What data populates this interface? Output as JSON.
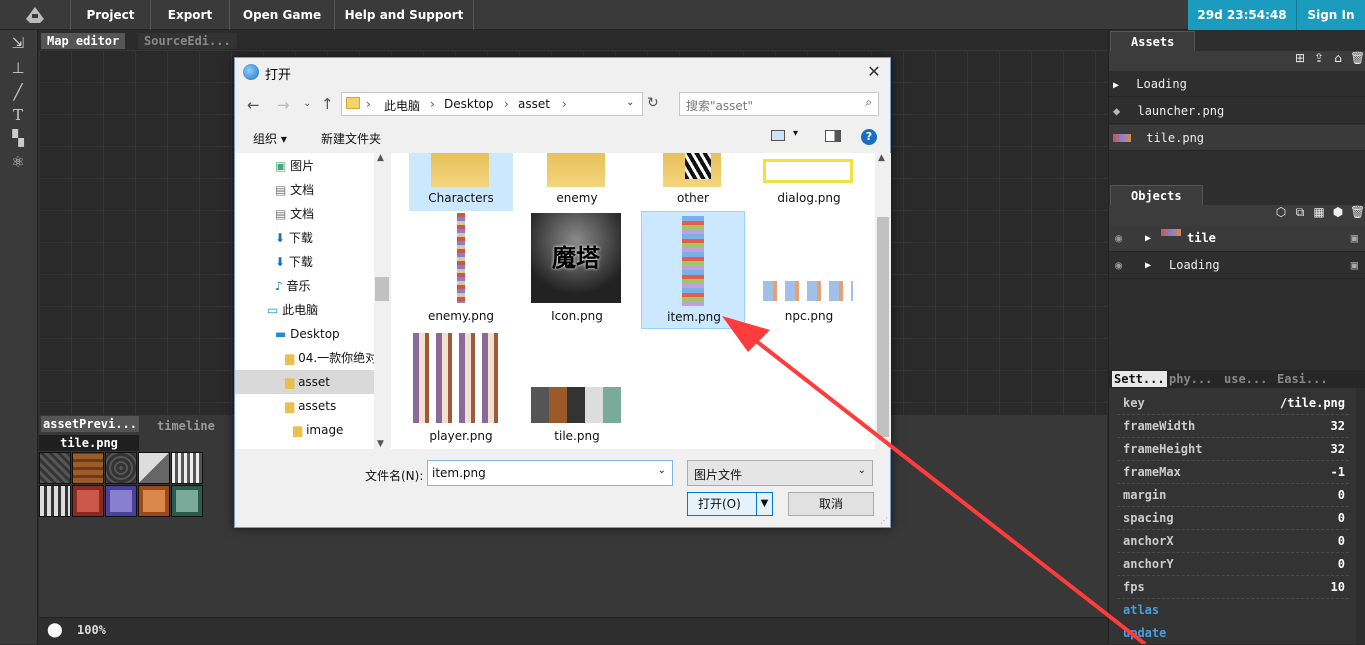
{
  "topbar": {
    "menus": [
      "Project",
      "Export",
      "Open Game",
      "Help and Support"
    ],
    "timer": "29d 23:54:48",
    "signin": "Sign In",
    "accent": "#1b9bbd"
  },
  "editor": {
    "tabs": [
      "Map editor",
      "SourceEdi..."
    ]
  },
  "bottom": {
    "tabs": [
      "assetPrevi...",
      "timeline"
    ],
    "subtab": "tile.png",
    "zoom": "100%"
  },
  "assets": {
    "title": "Assets",
    "items": [
      "Loading",
      "launcher.png",
      "tile.png"
    ]
  },
  "objects": {
    "title": "Objects",
    "items": [
      "tile",
      "Loading"
    ]
  },
  "settings": {
    "tabs": [
      "Sett...",
      "phy...",
      "use...",
      "Easi..."
    ],
    "rows": [
      {
        "k": "key",
        "v": "/tile.png"
      },
      {
        "k": "frameWidth",
        "v": "32"
      },
      {
        "k": "frameHeight",
        "v": "32"
      },
      {
        "k": "frameMax",
        "v": "-1"
      },
      {
        "k": "margin",
        "v": "0"
      },
      {
        "k": "spacing",
        "v": "0"
      },
      {
        "k": "anchorX",
        "v": "0"
      },
      {
        "k": "anchorY",
        "v": "0"
      },
      {
        "k": "fps",
        "v": "10"
      }
    ],
    "links": [
      "atlas",
      "update"
    ],
    "link_color": "#4a9fe0"
  },
  "dialog": {
    "title": "打开",
    "path": [
      "此电脑",
      "Desktop",
      "asset"
    ],
    "search_placeholder": "搜索\"asset\"",
    "organize": "组织 ▾",
    "new_folder": "新建文件夹",
    "nav": [
      "图片",
      "文档",
      "文档",
      "下载",
      "下载",
      "音乐",
      "此电脑",
      "Desktop",
      "04.一款你绝对",
      "asset",
      "assets",
      "image"
    ],
    "files": [
      "Characters",
      "enemy",
      "other",
      "dialog.png",
      "enemy.png",
      "Icon.png",
      "item.png",
      "npc.png",
      "player.png",
      "tile.png"
    ],
    "icon_text": "魔塔",
    "filename_label": "文件名(N):",
    "filename": "item.png",
    "filetype": "图片文件",
    "open": "打开(O)",
    "cancel": "取消"
  }
}
